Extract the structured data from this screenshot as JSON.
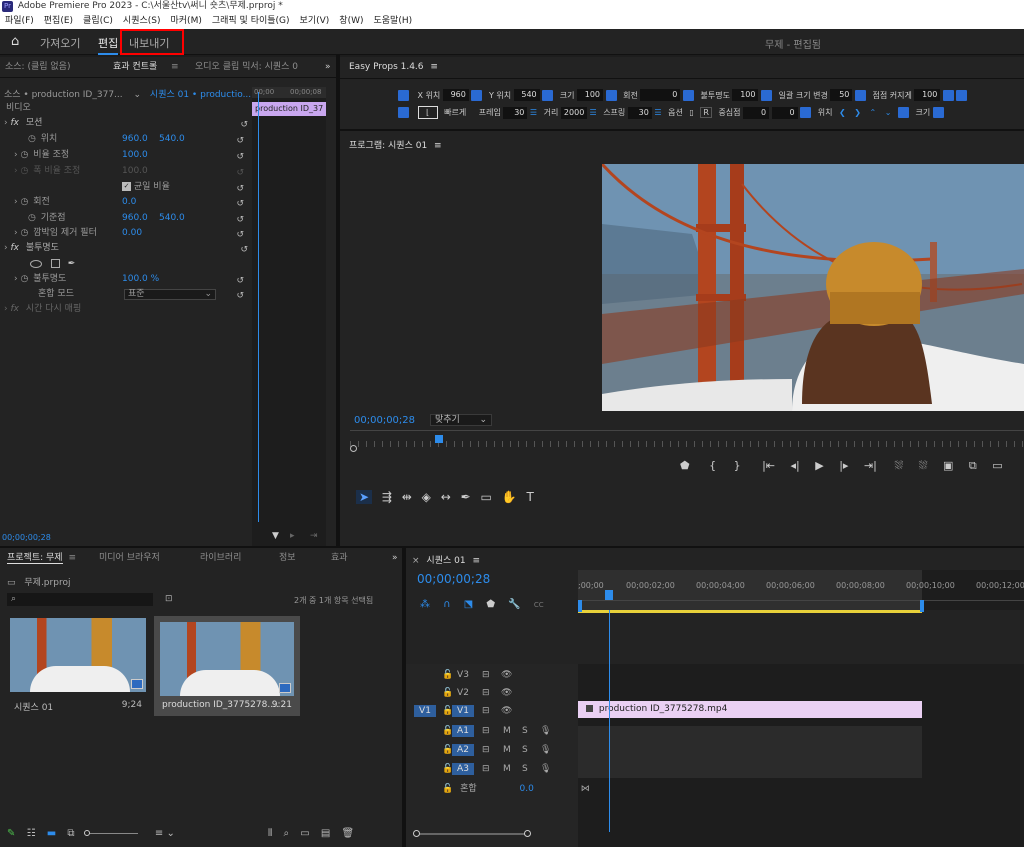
{
  "app": {
    "title": "Adobe Premiere Pro 2023 - C:\\서울산tv\\써니 숏츠\\무제.prproj *",
    "logo": "Pr"
  },
  "menu": [
    "파일(F)",
    "편집(E)",
    "클립(C)",
    "시퀀스(S)",
    "마커(M)",
    "그래픽 및 타이틀(G)",
    "보기(V)",
    "창(W)",
    "도움말(H)"
  ],
  "topbar": {
    "tabs": [
      "가져오기",
      "편집",
      "내보내기"
    ],
    "project": "무제 - 편집됨"
  },
  "source": {
    "tabs": [
      "소스: (클립 없음)",
      "효과 컨트롤",
      "오디오 클립 믹서: 시퀀스 0"
    ],
    "clip": "소스 • production ID_377...",
    "seq": "시퀀스 01 • productio...",
    "t_start": "00;00",
    "t_end": "00;00;08",
    "mini_clip": "production ID_37",
    "video": "비디오",
    "motion": "모션",
    "position": "위치",
    "pos_x": "960.0",
    "pos_y": "540.0",
    "scale": "비율 조정",
    "scale_v": "100.0",
    "scale_w": "폭 비율 조정",
    "scale_w_v": "100.0",
    "uniform": "균일 비율",
    "rotation": "회전",
    "rotation_v": "0.0",
    "anchor": "기준점",
    "anchor_x": "960.0",
    "anchor_y": "540.0",
    "flicker": "깜박임 제거 필터",
    "flicker_v": "0.00",
    "opacity_grp": "불투명도",
    "opacity": "불투명도",
    "opacity_v": "100.0 %",
    "blend": "혼합 모드",
    "blend_v": "표준",
    "timeremap": "시간 다시 매핑",
    "timecode": "00;00;00;28"
  },
  "easyprops": {
    "title": "Easy Props 1.4.6",
    "xpos_l": "X 위치",
    "xpos": "960",
    "ypos_l": "Y 위치",
    "ypos": "540",
    "size_l": "크기",
    "size": "100",
    "rot_l": "회전",
    "rot": "0",
    "op_l": "불투명도",
    "op": "100",
    "batch_l": "일괄 크기 변경",
    "batch": "50",
    "grow_l": "점점 커지게",
    "grow": "100",
    "fast": "빠르게",
    "frame_l": "프레임",
    "frame": "30",
    "dist_l": "거리",
    "dist": "2000",
    "spring_l": "스프링",
    "spring": "30",
    "opt": "옵션",
    "r": "R",
    "center_l": "중심점",
    "c1": "0",
    "c2": "0",
    "pos_l": "위치",
    "size2_l": "크기"
  },
  "program": {
    "title": "프로그램: 시퀀스 01",
    "timecode": "00;00;00;28",
    "fit": "맞추기"
  },
  "project": {
    "tabs": [
      "프로젝트: 무제",
      "미디어 브라우저",
      "라이브러리",
      "정보",
      "효과"
    ],
    "file": "무제.prproj",
    "count": "2개 중 1개 항목 선택됨",
    "items": [
      {
        "name": "시퀀스 01",
        "dur": "9;24"
      },
      {
        "name": "production ID_3775278....",
        "dur": "9:21"
      }
    ]
  },
  "timeline": {
    "title": "시퀀스 01",
    "timecode": "00;00;00;28",
    "ticks": [
      ";00;00",
      "00;00;02;00",
      "00;00;04;00",
      "00;00;06;00",
      "00;00;08;00",
      "00;00;10;00",
      "00;00;12;00"
    ],
    "tracks": [
      "V3",
      "V2",
      "V1",
      "A1",
      "A2",
      "A3"
    ],
    "src": "V1",
    "mix": "혼합",
    "mix_v": "0.0",
    "clip": "production ID_3775278.mp4",
    "m": "M",
    "s": "S"
  },
  "colors": {
    "accent": "#2d8ceb",
    "clip": "#e9b9f2",
    "highlight": "#ff0000"
  }
}
